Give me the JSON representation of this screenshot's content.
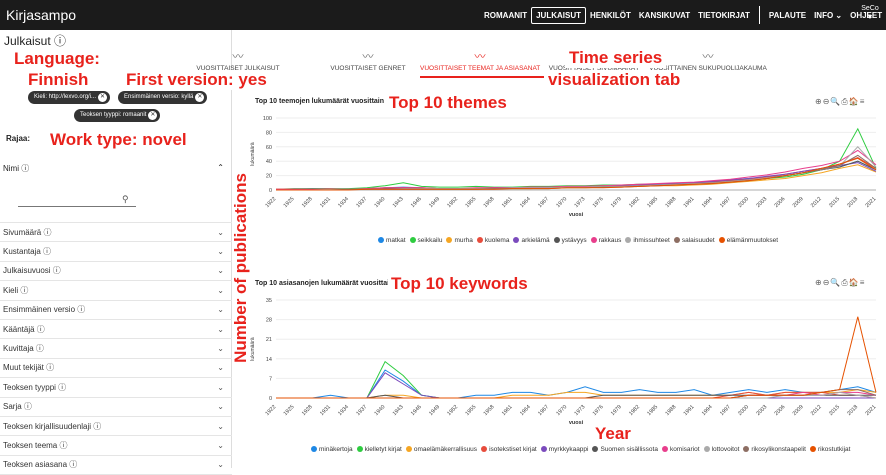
{
  "app": {
    "title": "Kirjasampo"
  },
  "nav": {
    "items": [
      "ROMAANIT",
      "JULKAISUT",
      "HENKILÖT",
      "KANSIKUVAT",
      "TIETOKIRJAT",
      "PALAUTE",
      "INFO ⌄",
      "OHJEET",
      "FI ⌄"
    ],
    "active_index": 1,
    "logo_text": "SeCo"
  },
  "page": {
    "heading": "Julkaisut ⓘ"
  },
  "chips": [
    "Kieli: http://lexvo.org/i...",
    "Ensimmäinen versio: kyllä",
    "Teoksen tyyppi: romaanit"
  ],
  "sidebar": {
    "rajaa": "Rajaa:",
    "nimi": "Nimi ⓘ",
    "search_icon": "search-icon",
    "filters": [
      "Sivumäärä ⓘ",
      "Kustantaja ⓘ",
      "Julkaisuvuosi ⓘ",
      "Kieli ⓘ",
      "Ensimmäinen versio ⓘ",
      "Kääntäjä ⓘ",
      "Kuvittaja ⓘ",
      "Muut tekijät ⓘ",
      "Teoksen tyyppi ⓘ",
      "Sarja ⓘ",
      "Teoksen kirjallisuudenlaji ⓘ",
      "Teoksen teema ⓘ",
      "Teoksen asiasana ⓘ"
    ]
  },
  "tabs": [
    "VUOSITTAISET JULKAISUT",
    "VUOSITTAISET GENRET",
    "VUOSITTAISET TEEMAT JA ASIASANAT",
    "VUOSITTAISET SIVUMÄÄRÄT",
    "VUOSITTAINEN SUKUPUOLIJAKAUMA"
  ],
  "active_tab": 2,
  "annotations": {
    "language": "Language:",
    "finnish": "Finnish",
    "first_version": "First version: yes",
    "work_type": "Work type: novel",
    "time_series": "Time series",
    "vis_tab": "visualization tab",
    "top_themes": "Top 10 themes",
    "top_keywords": "Top 10 keywords",
    "num_pub": "Number of publications",
    "year": "Year"
  },
  "toolbar_icons": "⊕⊖🔍⎙🏠≡",
  "chart_data": [
    {
      "type": "line",
      "title": "Top 10 teemojen lukumäärät vuosittain",
      "xlabel": "vuosi",
      "ylabel": "lukumäärä",
      "ylim": [
        0,
        100
      ],
      "yticks": [
        0,
        20,
        40,
        60,
        80,
        100
      ],
      "x": [
        "1922",
        "1925",
        "1928",
        "1931",
        "1934",
        "1937",
        "1940",
        "1943",
        "1946",
        "1949",
        "1952",
        "1955",
        "1958",
        "1961",
        "1964",
        "1967",
        "1970",
        "1973",
        "1976",
        "1979",
        "1982",
        "1985",
        "1988",
        "1991",
        "1994",
        "1997",
        "2000",
        "2003",
        "2006",
        "2009",
        "2012",
        "2015",
        "2018",
        "2021"
      ],
      "series": [
        {
          "name": "matkat",
          "color": "#1e88e5",
          "values": [
            1,
            1,
            2,
            1,
            1,
            2,
            3,
            4,
            3,
            2,
            2,
            2,
            3,
            3,
            4,
            4,
            5,
            5,
            6,
            6,
            7,
            8,
            9,
            10,
            12,
            14,
            16,
            18,
            20,
            24,
            28,
            32,
            40,
            28
          ]
        },
        {
          "name": "seikkailu",
          "color": "#2ecc40",
          "values": [
            1,
            2,
            2,
            2,
            2,
            3,
            6,
            10,
            5,
            4,
            4,
            5,
            4,
            4,
            5,
            5,
            6,
            6,
            7,
            7,
            8,
            8,
            9,
            10,
            12,
            13,
            14,
            16,
            18,
            22,
            28,
            40,
            85,
            30
          ]
        },
        {
          "name": "murha",
          "color": "#f5a623",
          "values": [
            1,
            1,
            1,
            1,
            1,
            1,
            2,
            2,
            2,
            1,
            1,
            1,
            2,
            2,
            2,
            3,
            3,
            3,
            4,
            4,
            5,
            6,
            6,
            7,
            8,
            10,
            12,
            14,
            16,
            20,
            24,
            30,
            35,
            25
          ]
        },
        {
          "name": "kuolema",
          "color": "#e74c3c",
          "values": [
            1,
            1,
            1,
            2,
            1,
            2,
            3,
            3,
            3,
            2,
            2,
            2,
            3,
            3,
            4,
            4,
            5,
            5,
            6,
            6,
            7,
            8,
            9,
            10,
            11,
            13,
            15,
            18,
            22,
            26,
            30,
            36,
            45,
            30
          ]
        },
        {
          "name": "arkielämä",
          "color": "#7b4bbd",
          "values": [
            0,
            1,
            1,
            1,
            1,
            1,
            2,
            3,
            2,
            2,
            2,
            2,
            3,
            3,
            3,
            4,
            4,
            5,
            5,
            6,
            7,
            8,
            9,
            10,
            12,
            14,
            16,
            19,
            22,
            26,
            30,
            34,
            38,
            26
          ]
        },
        {
          "name": "ystävyys",
          "color": "#555555",
          "values": [
            0,
            0,
            1,
            1,
            1,
            1,
            2,
            2,
            2,
            2,
            2,
            2,
            2,
            3,
            3,
            3,
            4,
            4,
            5,
            5,
            6,
            7,
            8,
            9,
            10,
            12,
            14,
            16,
            20,
            24,
            28,
            32,
            40,
            28
          ]
        },
        {
          "name": "rakkaus",
          "color": "#e83e8c",
          "values": [
            1,
            1,
            1,
            1,
            1,
            2,
            3,
            3,
            3,
            2,
            2,
            3,
            3,
            3,
            4,
            4,
            5,
            5,
            6,
            7,
            8,
            9,
            10,
            11,
            13,
            15,
            18,
            21,
            25,
            30,
            34,
            40,
            55,
            35
          ]
        },
        {
          "name": "ihmissuhteet",
          "color": "#aaaaaa",
          "values": [
            0,
            0,
            0,
            1,
            1,
            1,
            1,
            2,
            2,
            2,
            2,
            2,
            2,
            3,
            3,
            3,
            4,
            4,
            5,
            5,
            6,
            7,
            8,
            9,
            10,
            12,
            14,
            17,
            20,
            24,
            28,
            33,
            60,
            32
          ]
        },
        {
          "name": "salaisuudet",
          "color": "#8d6e63",
          "values": [
            0,
            0,
            0,
            0,
            1,
            1,
            1,
            1,
            1,
            1,
            1,
            1,
            2,
            2,
            2,
            2,
            3,
            3,
            4,
            4,
            5,
            6,
            7,
            8,
            9,
            11,
            13,
            16,
            20,
            24,
            28,
            34,
            48,
            30
          ]
        },
        {
          "name": "elämänmuutokset",
          "color": "#e65100",
          "values": [
            0,
            0,
            0,
            0,
            0,
            1,
            1,
            1,
            1,
            1,
            1,
            1,
            1,
            2,
            2,
            2,
            3,
            3,
            3,
            4,
            5,
            6,
            7,
            8,
            9,
            11,
            13,
            16,
            20,
            24,
            30,
            36,
            44,
            28
          ]
        }
      ]
    },
    {
      "type": "line",
      "title": "Top 10 asiasanojen lukumäärät vuosittain",
      "xlabel": "vuosi",
      "ylabel": "lukumäärä",
      "ylim": [
        0,
        35
      ],
      "yticks": [
        0,
        7,
        14,
        21,
        28,
        35
      ],
      "x": [
        "1922",
        "1925",
        "1928",
        "1931",
        "1934",
        "1937",
        "1940",
        "1943",
        "1946",
        "1949",
        "1952",
        "1955",
        "1958",
        "1961",
        "1964",
        "1967",
        "1970",
        "1973",
        "1976",
        "1979",
        "1982",
        "1985",
        "1988",
        "1991",
        "1994",
        "1997",
        "2000",
        "2003",
        "2006",
        "2009",
        "2012",
        "2015",
        "2018",
        "2021"
      ],
      "series": [
        {
          "name": "minäkertoja",
          "color": "#1e88e5",
          "values": [
            0,
            0,
            0,
            1,
            0,
            0,
            10,
            6,
            1,
            0,
            0,
            1,
            1,
            2,
            2,
            1,
            2,
            4,
            2,
            2,
            3,
            2,
            2,
            3,
            1,
            2,
            3,
            2,
            3,
            2,
            2,
            3,
            4,
            2
          ]
        },
        {
          "name": "kielletyt kirjat",
          "color": "#2ecc40",
          "values": [
            0,
            0,
            0,
            0,
            0,
            0,
            13,
            8,
            1,
            0,
            0,
            0,
            0,
            0,
            0,
            0,
            0,
            0,
            0,
            0,
            0,
            0,
            0,
            0,
            0,
            0,
            0,
            0,
            0,
            0,
            0,
            0,
            0,
            0
          ]
        },
        {
          "name": "omaelämäkerrallisuus",
          "color": "#f5a623",
          "values": [
            0,
            0,
            0,
            0,
            0,
            0,
            1,
            1,
            0,
            0,
            0,
            0,
            0,
            1,
            1,
            1,
            2,
            2,
            1,
            1,
            1,
            1,
            1,
            1,
            1,
            1,
            2,
            1,
            2,
            2,
            2,
            2,
            3,
            2
          ]
        },
        {
          "name": "isotekstiset kirjat",
          "color": "#e74c3c",
          "values": [
            0,
            0,
            0,
            0,
            0,
            0,
            0,
            0,
            0,
            0,
            0,
            0,
            0,
            0,
            0,
            0,
            0,
            0,
            0,
            0,
            0,
            0,
            0,
            0,
            0,
            1,
            2,
            1,
            2,
            2,
            2,
            1,
            1,
            0
          ]
        },
        {
          "name": "myrkkykaappi",
          "color": "#7b4bbd",
          "values": [
            0,
            0,
            0,
            0,
            0,
            0,
            9,
            5,
            1,
            0,
            0,
            0,
            0,
            0,
            0,
            0,
            0,
            0,
            0,
            0,
            0,
            0,
            0,
            0,
            0,
            0,
            0,
            0,
            0,
            0,
            0,
            0,
            0,
            0
          ]
        },
        {
          "name": "Suomen sisällissota",
          "color": "#555555",
          "values": [
            0,
            0,
            0,
            0,
            0,
            0,
            1,
            0,
            0,
            0,
            0,
            0,
            0,
            0,
            0,
            0,
            0,
            0,
            1,
            1,
            1,
            1,
            1,
            1,
            1,
            1,
            1,
            1,
            1,
            1,
            1,
            1,
            1,
            1
          ]
        },
        {
          "name": "komisariot",
          "color": "#e83e8c",
          "values": [
            0,
            0,
            0,
            0,
            0,
            0,
            0,
            0,
            0,
            0,
            0,
            0,
            0,
            0,
            0,
            0,
            0,
            0,
            0,
            0,
            0,
            0,
            0,
            0,
            0,
            0,
            1,
            1,
            1,
            2,
            1,
            2,
            2,
            1
          ]
        },
        {
          "name": "lottovoitot",
          "color": "#aaaaaa",
          "values": [
            0,
            0,
            0,
            0,
            0,
            0,
            0,
            0,
            0,
            0,
            0,
            0,
            0,
            0,
            0,
            0,
            0,
            0,
            0,
            0,
            0,
            0,
            0,
            0,
            0,
            0,
            0,
            0,
            1,
            1,
            1,
            2,
            1,
            0
          ]
        },
        {
          "name": "rikosylikonstaapelit",
          "color": "#8d6e63",
          "values": [
            0,
            0,
            0,
            0,
            0,
            0,
            0,
            0,
            0,
            0,
            0,
            0,
            0,
            0,
            0,
            0,
            0,
            0,
            0,
            0,
            0,
            0,
            0,
            0,
            0,
            0,
            1,
            1,
            1,
            1,
            2,
            3,
            3,
            1
          ]
        },
        {
          "name": "rikostutkijat",
          "color": "#e65100",
          "values": [
            0,
            0,
            0,
            0,
            0,
            0,
            0,
            0,
            0,
            0,
            0,
            0,
            0,
            0,
            0,
            0,
            0,
            0,
            0,
            0,
            0,
            0,
            0,
            0,
            0,
            0,
            1,
            1,
            1,
            1,
            2,
            3,
            29,
            2
          ]
        }
      ]
    }
  ]
}
